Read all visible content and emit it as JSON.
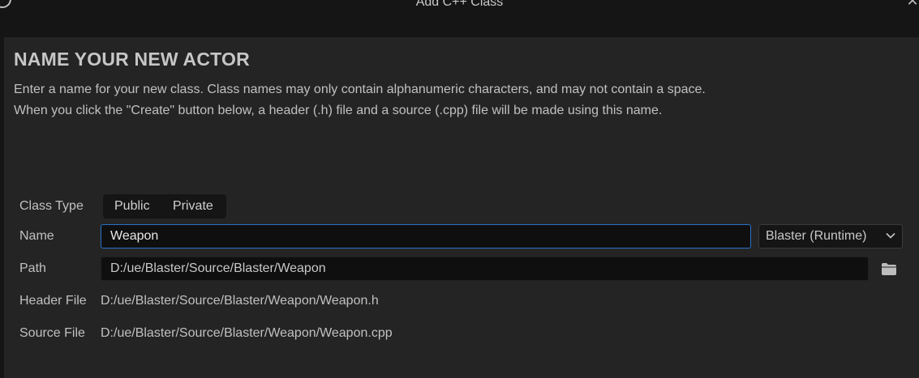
{
  "window": {
    "title": "Add C++ Class",
    "close_icon": "close-icon",
    "logo_icon": "unreal-logo-icon"
  },
  "header": {
    "title": "NAME YOUR NEW ACTOR",
    "description_line1": "Enter a name for your new class. Class names may only contain alphanumeric characters, and may not contain a space.",
    "description_line2": "When you click the \"Create\" button below, a header (.h) file and a source (.cpp) file will be made using this name."
  },
  "form": {
    "class_type": {
      "label": "Class Type",
      "options": [
        "Public",
        "Private"
      ]
    },
    "name": {
      "label": "Name",
      "value": "Weapon"
    },
    "module": {
      "value": "Blaster (Runtime)"
    },
    "path": {
      "label": "Path",
      "value": "D:/ue/Blaster/Source/Blaster/Weapon",
      "browse_icon": "folder-icon"
    },
    "header_file": {
      "label": "Header File",
      "value": "D:/ue/Blaster/Source/Blaster/Weapon/Weapon.h"
    },
    "source_file": {
      "label": "Source File",
      "value": "D:/ue/Blaster/Source/Blaster/Weapon/Weapon.cpp"
    }
  },
  "colors": {
    "accent": "#2a70c8",
    "panel": "#242424",
    "background": "#151515"
  }
}
